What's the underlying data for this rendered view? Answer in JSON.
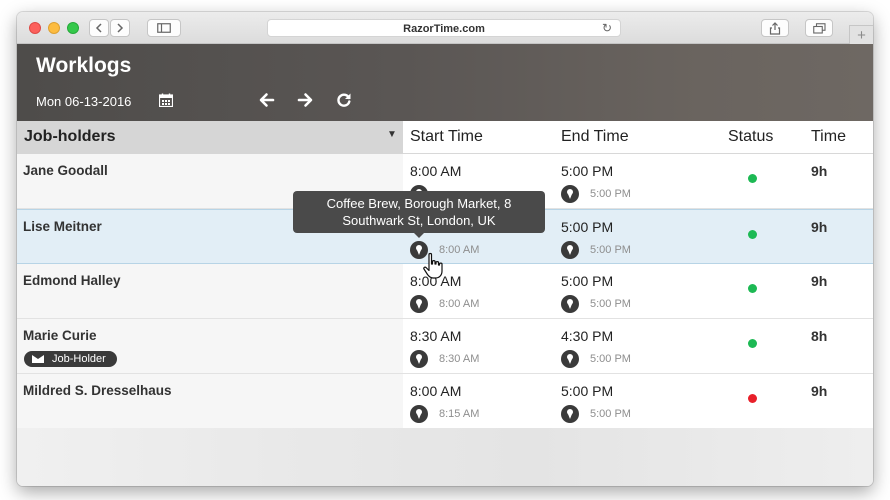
{
  "browser": {
    "url": "RazorTime.com"
  },
  "app": {
    "title": "Worklogs",
    "date": "Mon 06-13-2016",
    "icons": [
      "calendar-icon",
      "arrow-left-icon",
      "arrow-right-icon",
      "refresh-icon"
    ]
  },
  "table": {
    "columns": {
      "jobholders": "Job-holders",
      "start": "Start Time",
      "end": "End Time",
      "status": "Status",
      "time": "Time"
    },
    "rows": [
      {
        "name": "Jane Goodall",
        "start": "8:00 AM",
        "start_loc": "",
        "end": "5:00 PM",
        "end_loc": "5:00 PM",
        "status": "green",
        "time": "9h"
      },
      {
        "name": "Lise Meitner",
        "start": "",
        "start_loc": "8:00 AM",
        "end": "5:00 PM",
        "end_loc": "5:00 PM",
        "status": "green",
        "time": "9h"
      },
      {
        "name": "Edmond Halley",
        "start": "8:00 AM",
        "start_loc": "8:00 AM",
        "end": "5:00 PM",
        "end_loc": "5:00 PM",
        "status": "green",
        "time": "9h"
      },
      {
        "name": "Marie Curie",
        "badge": "Job-Holder",
        "start": "8:30 AM",
        "start_loc": "8:30 AM",
        "end": "4:30 PM",
        "end_loc": "5:00 PM",
        "status": "green",
        "time": "8h"
      },
      {
        "name": "Mildred S. Dresselhaus",
        "start": "8:00 AM",
        "start_loc": "8:15 AM",
        "end": "5:00 PM",
        "end_loc": "5:00 PM",
        "status": "red",
        "time": "9h"
      }
    ]
  },
  "tooltip": {
    "line1": "Coffee Brew, Borough Market, 8",
    "line2": "Southwark St, London, UK"
  },
  "colors": {
    "status_green": "#1db954",
    "status_red": "#e8202a",
    "header_bg": "#55514e",
    "selected_row": "#e2eef6"
  }
}
